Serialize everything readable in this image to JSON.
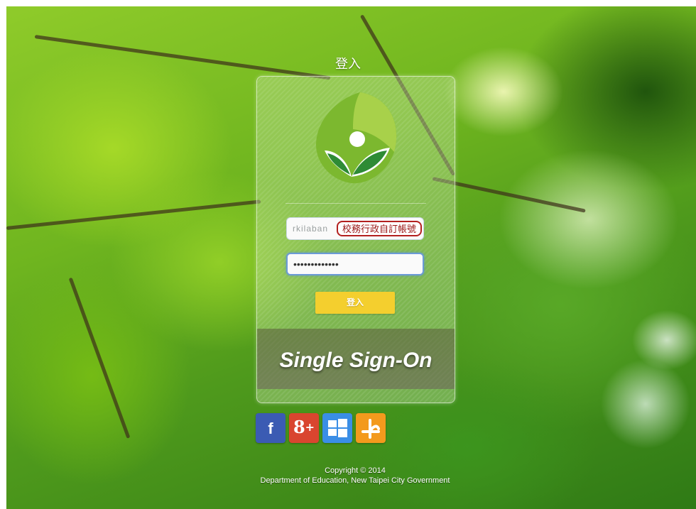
{
  "page": {
    "title": "登入"
  },
  "login": {
    "username_value": "rkilaban",
    "username_annotation": "校務行政自訂帳號",
    "password_mask": "•••••••••••••",
    "submit_label": "登入"
  },
  "banner": {
    "text": "Single Sign-On"
  },
  "social": [
    {
      "icon": "facebook-icon",
      "glyph": "f",
      "color": "#3b5bb3"
    },
    {
      "icon": "google-plus-icon",
      "glyph": "8+",
      "color": "#d9452f"
    },
    {
      "icon": "windows-icon",
      "glyph": "",
      "color": "#3a8ee6"
    },
    {
      "icon": "yahoo-openid-icon",
      "glyph": "ቍ",
      "color": "#f39a1d"
    }
  ],
  "footer": {
    "copyright": "Copyright © 2014",
    "organization": "Department of Education, New Taipei City Government"
  },
  "colors": {
    "button": "#f4cf2e",
    "annotation_border": "#b3201f"
  }
}
